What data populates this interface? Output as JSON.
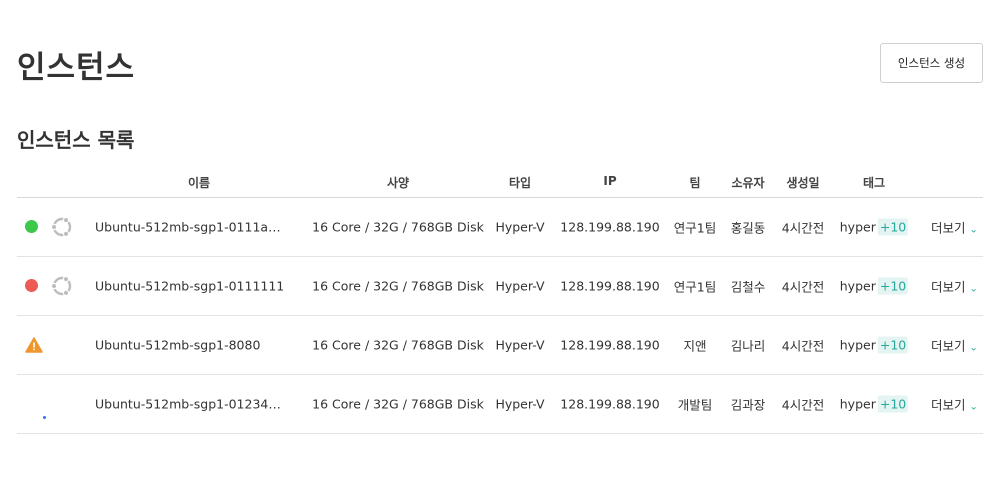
{
  "page": {
    "title": "인스턴스",
    "create_button": "인스턴스 생성",
    "section_title": "인스턴스 목록"
  },
  "table": {
    "headers": {
      "name": "이름",
      "spec": "사양",
      "type": "타입",
      "ip": "IP",
      "team": "팀",
      "owner": "소유자",
      "created": "생성일",
      "tag": "태그"
    },
    "rows": [
      {
        "status": "running",
        "status_color": "#3cc84a",
        "os_icon": "ubuntu-icon",
        "name": "Ubuntu-512mb-sgp1-0111aaa…",
        "spec": "16 Core / 32G / 768GB Disk",
        "type": "Hyper-V",
        "ip": "128.199.88.190",
        "team": "연구1팀",
        "owner": "홍길동",
        "created": "4시간전",
        "tag": "hyper",
        "tag_extra": "+10",
        "more": "더보기"
      },
      {
        "status": "stopped",
        "status_color": "#ee5a55",
        "os_icon": "ubuntu-icon",
        "name": "Ubuntu-512mb-sgp1-0111111",
        "spec": "16 Core / 32G / 768GB Disk",
        "type": "Hyper-V",
        "ip": "128.199.88.190",
        "team": "연구1팀",
        "owner": "김철수",
        "created": "4시간전",
        "tag": "hyper",
        "tag_extra": "+10",
        "more": "더보기"
      },
      {
        "status": "warning",
        "status_color": "#f0962e",
        "os_icon": "",
        "name": "Ubuntu-512mb-sgp1-8080",
        "spec": "16 Core / 32G / 768GB Disk",
        "type": "Hyper-V",
        "ip": "128.199.88.190",
        "team": "지앤",
        "owner": "김나리",
        "created": "4시간전",
        "tag": "hyper",
        "tag_extra": "+10",
        "more": "더보기"
      },
      {
        "status": "pending",
        "status_color": "#3b6df0",
        "os_icon": "",
        "name": "Ubuntu-512mb-sgp1-0123456…",
        "spec": "16 Core / 32G / 768GB Disk",
        "type": "Hyper-V",
        "ip": "128.199.88.190",
        "team": "개발팀",
        "owner": "김과장",
        "created": "4시간전",
        "tag": "hyper",
        "tag_extra": "+10",
        "more": "더보기"
      }
    ]
  }
}
